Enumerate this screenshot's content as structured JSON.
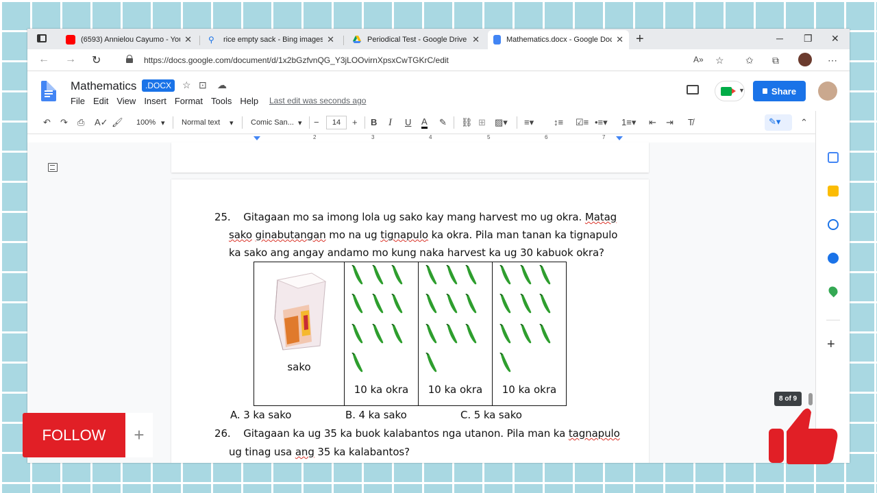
{
  "tabs": [
    {
      "title": "(6593) Annielou Cayumo - YouTube",
      "icon": "youtube-icon",
      "color": "#ff0000"
    },
    {
      "title": "rice empty sack - Bing images",
      "icon": "search-icon",
      "color": "#1a73e8"
    },
    {
      "title": "Periodical Test - Google Drive",
      "icon": "google-drive-icon",
      "color": "#fbbc04"
    },
    {
      "title": "Mathematics.docx - Google Docs",
      "icon": "google-docs-icon",
      "color": "#4285f4"
    }
  ],
  "address": {
    "url": "https://docs.google.com/document/d/1x2bGzfvnQG_Y3jLOOvirnXpsxCwTGKrC/edit"
  },
  "doc": {
    "title": "Mathematics",
    "badge": ".DOCX",
    "menu": [
      "File",
      "Edit",
      "View",
      "Insert",
      "Format",
      "Tools",
      "Help"
    ],
    "last_edit": "Last edit was seconds ago",
    "share": "Share"
  },
  "toolbar": {
    "zoom": "100%",
    "style": "Normal text",
    "font": "Comic San...",
    "font_size": "14",
    "minus": "−",
    "plus": "+"
  },
  "ruler": [
    "2",
    "3",
    "4",
    "5",
    "6",
    "7"
  ],
  "question25": {
    "number": "25.",
    "line1_pre": "Gitagaan mo sa imong lola ug sako kay mang harvest mo ug okra. ",
    "line1_sp": "Matag",
    "line2_sp1": "sako",
    "line2_sp2": "ginabutangan",
    "line2_mid": " mo na ug ",
    "line2_sp3": "tignapulo",
    "line2_post": " ka okra. Pila man tanan ka tignapulo",
    "line3": "ka sako ang angay andamo mo kung naka harvest ka ug 30 kabuok okra?",
    "sack_label": "sako",
    "okra_label": "10 ka okra",
    "choices": [
      "A. 3 ka sako",
      "B. 4 ka sako",
      "C. 5 ka sako"
    ]
  },
  "question26": {
    "number": "26.",
    "line1_pre": "Gitagaan ka ug 35 ka buok kalabantos nga utanon. Pila man ka ",
    "line1_sp": "tagnapulo",
    "line2_pre": "ug tinag usa ",
    "line2_sp": "ang",
    "line2_post": " 35 ka kalabantos?"
  },
  "page_indicator": "8 of 9",
  "overlay": {
    "follow": "FOLLOW",
    "plus": "+"
  },
  "colors": {
    "okra": "#2e9e2e",
    "accent": "#1a73e8",
    "follow": "#e11f26"
  }
}
